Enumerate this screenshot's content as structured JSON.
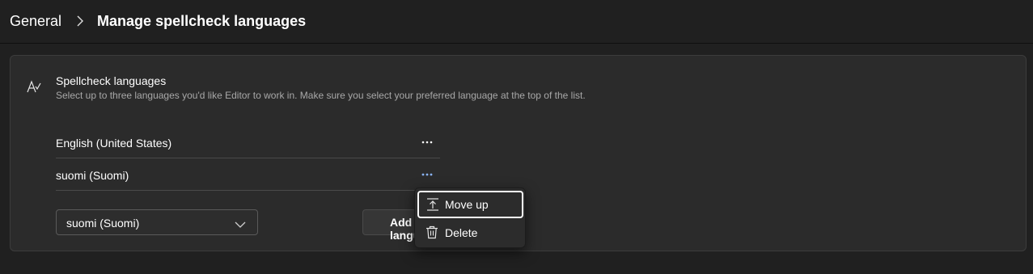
{
  "breadcrumb": {
    "parent": "General",
    "current": "Manage spellcheck languages"
  },
  "section": {
    "icon": "spellcheck-icon",
    "title": "Spellcheck languages",
    "subtitle": "Select up to three languages you'd like Editor to work in. Make sure you select your preferred language at the top of the list."
  },
  "languages": [
    {
      "name": "English (United States)",
      "more_icon": "more-horizontal-icon"
    },
    {
      "name": "suomi (Suomi)",
      "more_icon": "more-horizontal-icon"
    }
  ],
  "add_language": {
    "selected": "suomi (Suomi)",
    "button_label": "Add language"
  },
  "context_menu": {
    "items": [
      {
        "label": "Move up",
        "icon": "move-up-icon"
      },
      {
        "label": "Delete",
        "icon": "trash-icon"
      }
    ]
  },
  "colors": {
    "background": "#202020",
    "card": "#2b2b2b",
    "accent_more": "#8ab4f8"
  }
}
